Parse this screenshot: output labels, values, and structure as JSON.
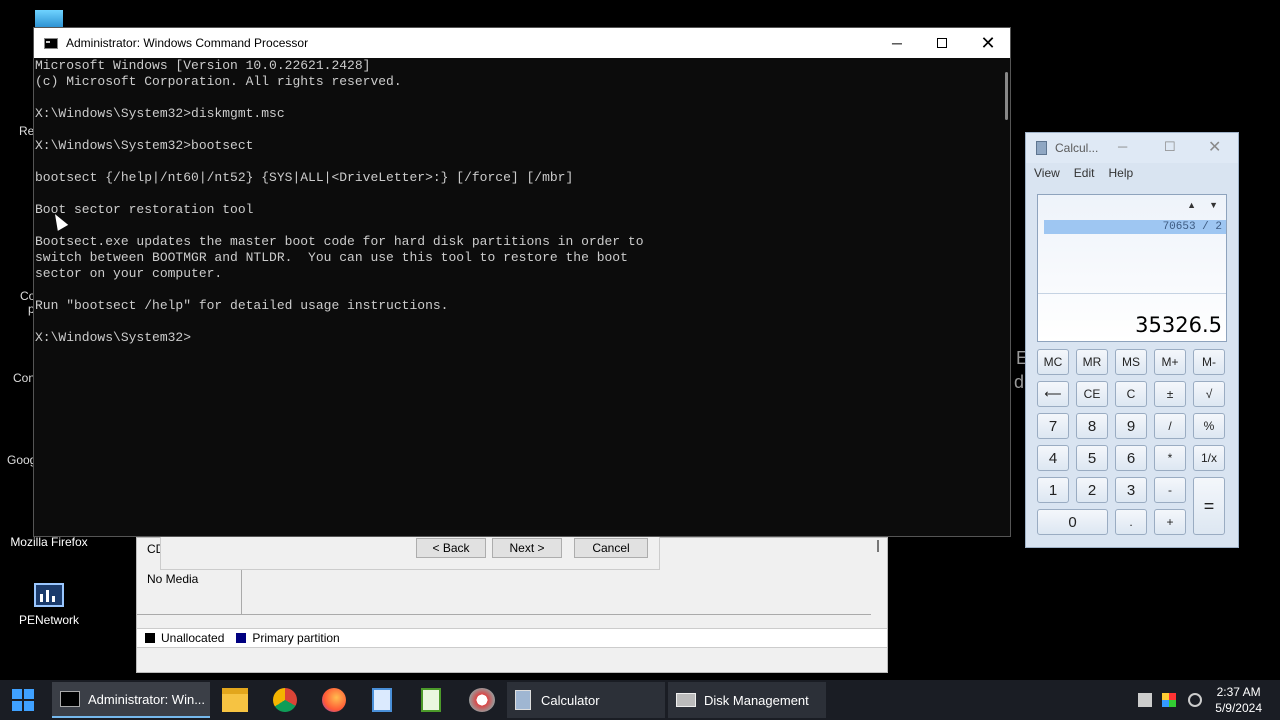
{
  "desktop": {
    "icons": [
      {
        "label": "Mozilla Firefox"
      },
      {
        "label": "PENetwork"
      }
    ],
    "partial_labels": [
      "Re",
      "Co",
      "p",
      "Con",
      "Goog",
      "E",
      "d"
    ]
  },
  "disk_management": {
    "cd_label": "CD",
    "no_media": "No Media",
    "legend_unallocated": "Unallocated",
    "legend_primary": "Primary partition",
    "colors": {
      "unallocated": "#000000",
      "primary": "#000080"
    }
  },
  "wizard": {
    "back_label": "< Back",
    "next_label": "Next >",
    "cancel_label": "Cancel"
  },
  "cmd": {
    "title": "Administrator: Windows Command Processor",
    "lines": [
      "Microsoft Windows [Version 10.0.22621.2428]",
      "(c) Microsoft Corporation. All rights reserved.",
      "",
      "X:\\Windows\\System32>diskmgmt.msc",
      "",
      "X:\\Windows\\System32>bootsect",
      "",
      "bootsect {/help|/nt60|/nt52} {SYS|ALL|<DriveLetter>:} [/force] [/mbr]",
      "",
      "Boot sector restoration tool",
      "",
      "Bootsect.exe updates the master boot code for hard disk partitions in order to",
      "switch between BOOTMGR and NTLDR.  You can use this tool to restore the boot",
      "sector on your computer.",
      "",
      "Run \"bootsect /help\" for detailed usage instructions.",
      "",
      "X:\\Windows\\System32>"
    ]
  },
  "calculator": {
    "title": "Calcul...",
    "menu": [
      "View",
      "Edit",
      "Help"
    ],
    "history_expression": "70653 / 2",
    "display_value": "35326.5",
    "keys": [
      [
        "MC",
        "MR",
        "MS",
        "M+",
        "M-"
      ],
      [
        "⟵",
        "CE",
        "C",
        "±",
        "√"
      ],
      [
        "7",
        "8",
        "9",
        "/",
        "%"
      ],
      [
        "4",
        "5",
        "6",
        "*",
        "1/x"
      ],
      [
        "1",
        "2",
        "3",
        "-",
        "="
      ],
      [
        "0",
        ".",
        "+"
      ]
    ]
  },
  "taskbar": {
    "items": [
      {
        "label": "Administrator: Win..."
      },
      {
        "label": "Calculator"
      },
      {
        "label": "Disk Management"
      }
    ],
    "time": "2:37 AM",
    "date": "5/9/2024"
  }
}
